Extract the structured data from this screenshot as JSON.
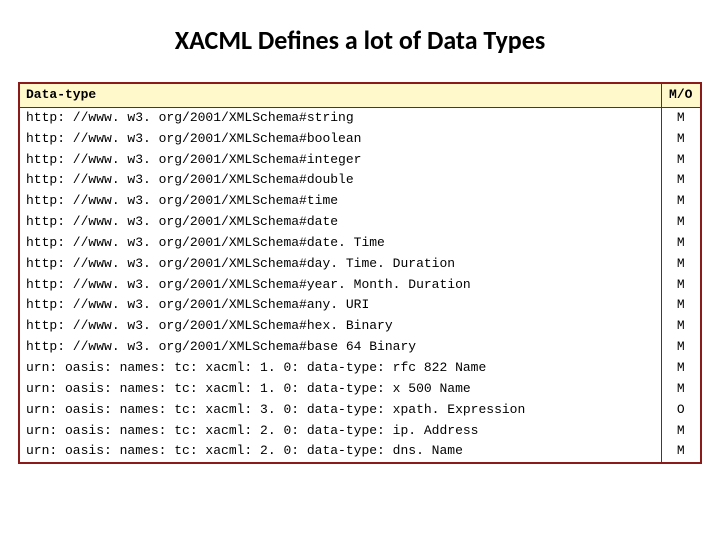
{
  "title": "XACML Defines a lot of Data Types",
  "table": {
    "headers": {
      "datatype": "Data-type",
      "mo": "M/O"
    },
    "rows": [
      {
        "uri": "http: //www. w3. org/2001/XMLSchema#string",
        "mo": "M"
      },
      {
        "uri": "http: //www. w3. org/2001/XMLSchema#boolean",
        "mo": "M"
      },
      {
        "uri": "http: //www. w3. org/2001/XMLSchema#integer",
        "mo": "M"
      },
      {
        "uri": "http: //www. w3. org/2001/XMLSchema#double",
        "mo": "M"
      },
      {
        "uri": "http: //www. w3. org/2001/XMLSchema#time",
        "mo": "M"
      },
      {
        "uri": "http: //www. w3. org/2001/XMLSchema#date",
        "mo": "M"
      },
      {
        "uri": "http: //www. w3. org/2001/XMLSchema#date. Time",
        "mo": "M"
      },
      {
        "uri": "http: //www. w3. org/2001/XMLSchema#day. Time. Duration",
        "mo": "M"
      },
      {
        "uri": "http: //www. w3. org/2001/XMLSchema#year. Month. Duration",
        "mo": "M"
      },
      {
        "uri": "http: //www. w3. org/2001/XMLSchema#any. URI",
        "mo": "M"
      },
      {
        "uri": "http: //www. w3. org/2001/XMLSchema#hex. Binary",
        "mo": "M"
      },
      {
        "uri": "http: //www. w3. org/2001/XMLSchema#base 64 Binary",
        "mo": "M"
      },
      {
        "uri": "urn: oasis: names: tc: xacml: 1. 0: data-type: rfc 822 Name",
        "mo": "M"
      },
      {
        "uri": "urn: oasis: names: tc: xacml: 1. 0: data-type: x 500 Name",
        "mo": "M"
      },
      {
        "uri": "urn: oasis: names: tc: xacml: 3. 0: data-type: xpath. Expression",
        "mo": "O"
      },
      {
        "uri": "urn: oasis: names: tc: xacml: 2. 0: data-type: ip. Address",
        "mo": "M"
      },
      {
        "uri": "urn: oasis: names: tc: xacml: 2. 0: data-type: dns. Name",
        "mo": "M"
      }
    ]
  }
}
